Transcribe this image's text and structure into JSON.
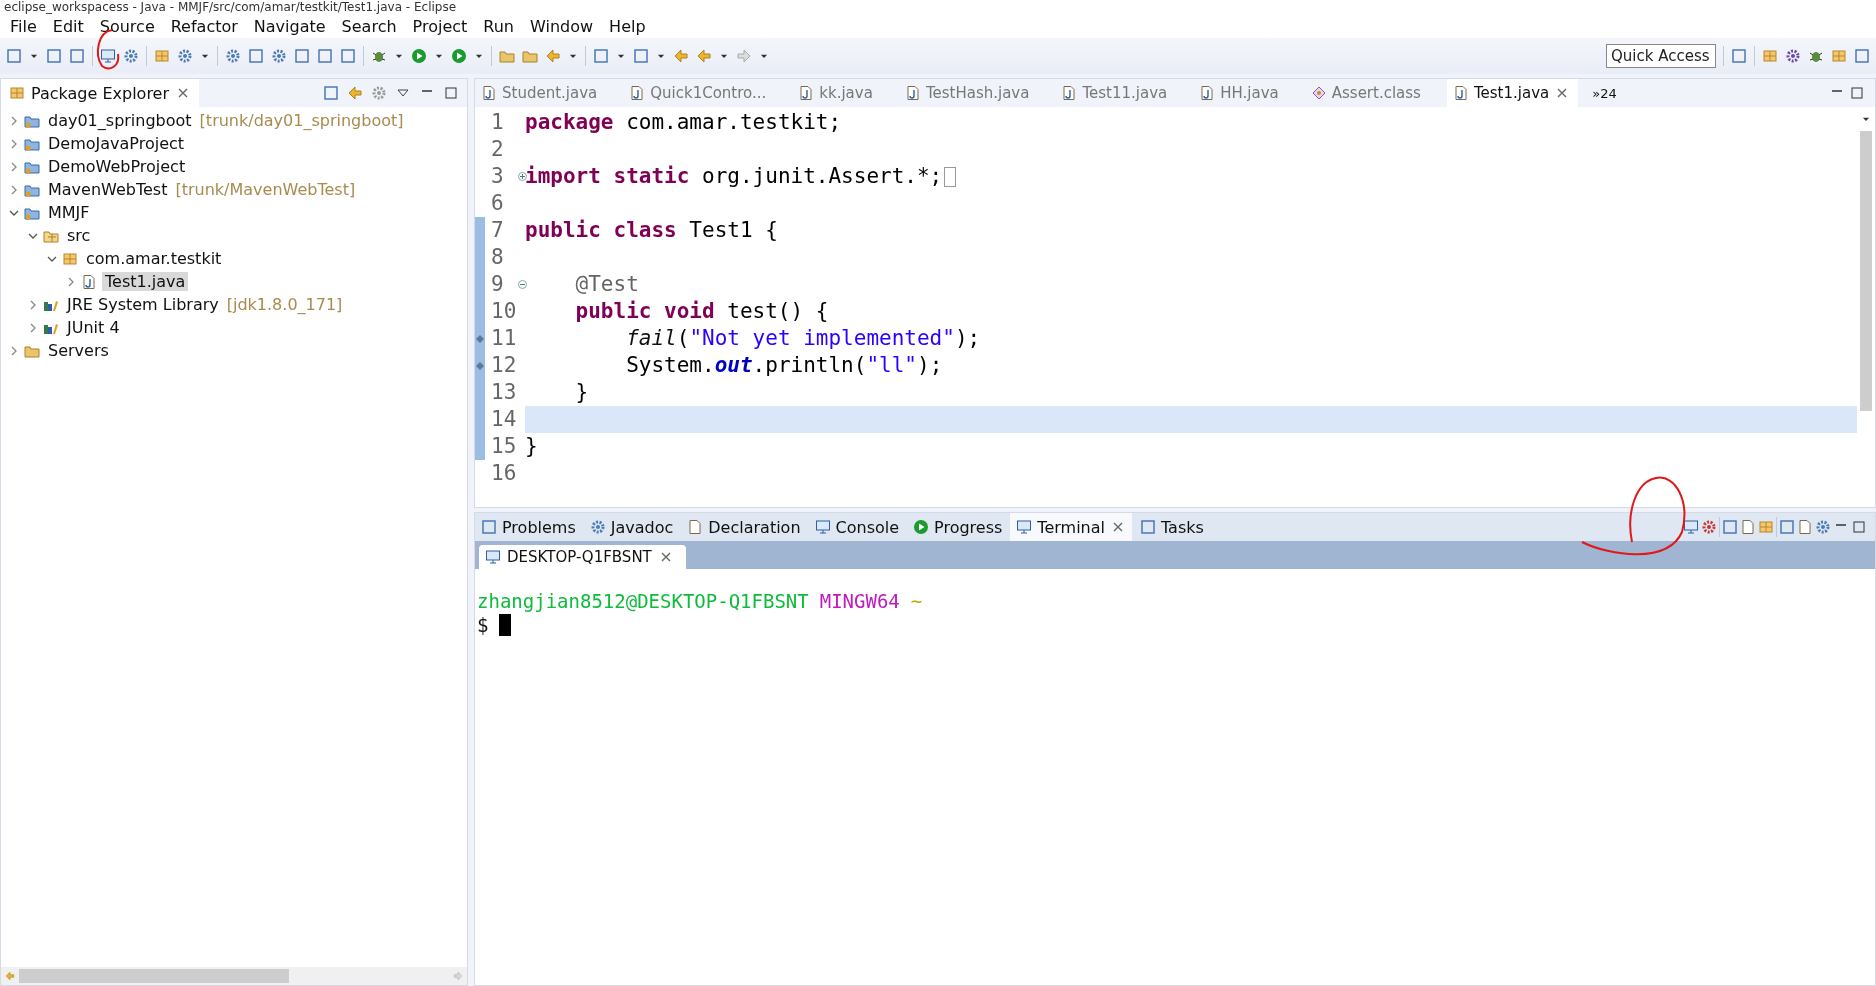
{
  "window": {
    "title": "eclipse_workspacess - Java - MMJF/src/com/amar/testkit/Test1.java - Eclipse"
  },
  "menu": [
    "File",
    "Edit",
    "Source",
    "Refactor",
    "Navigate",
    "Search",
    "Project",
    "Run",
    "Window",
    "Help"
  ],
  "quick_access": {
    "placeholder": "Quick Access"
  },
  "package_explorer": {
    "title": "Package Explorer",
    "items": [
      {
        "label": "day01_springboot",
        "decoration": "[trunk/day01_springboot]",
        "kind": "project",
        "expanded": false,
        "selected": false
      },
      {
        "label": "DemoJavaProject",
        "kind": "project",
        "expanded": false,
        "selected": false
      },
      {
        "label": "DemoWebProject",
        "kind": "project",
        "expanded": false,
        "selected": false
      },
      {
        "label": "MavenWebTest",
        "decoration": "[trunk/MavenWebTest]",
        "kind": "project",
        "expanded": false,
        "selected": false
      },
      {
        "label": "MMJF",
        "kind": "project",
        "expanded": true,
        "selected": false,
        "children": [
          {
            "label": "src",
            "kind": "source",
            "expanded": true,
            "selected": false,
            "children": [
              {
                "label": "com.amar.testkit",
                "kind": "package",
                "expanded": true,
                "selected": false,
                "children": [
                  {
                    "label": "Test1.java",
                    "kind": "java",
                    "expanded": false,
                    "selected": true
                  }
                ]
              }
            ]
          },
          {
            "label": "JRE System Library",
            "decoration": "[jdk1.8.0_171]",
            "kind": "library",
            "expanded": false,
            "selected": false
          },
          {
            "label": "JUnit 4",
            "kind": "library",
            "expanded": false,
            "selected": false
          }
        ]
      },
      {
        "label": "Servers",
        "kind": "folder",
        "expanded": false,
        "selected": false
      }
    ]
  },
  "editor_tabs": [
    {
      "label": "Student.java",
      "kind": "java",
      "selected": false
    },
    {
      "label": "Quick1Contro...",
      "kind": "java",
      "selected": false
    },
    {
      "label": "kk.java",
      "kind": "java",
      "selected": false
    },
    {
      "label": "TestHash.java",
      "kind": "java",
      "selected": false
    },
    {
      "label": "Test11.java",
      "kind": "java",
      "selected": false
    },
    {
      "label": "HH.java",
      "kind": "java",
      "selected": false
    },
    {
      "label": "Assert.class",
      "kind": "class",
      "selected": false
    },
    {
      "label": "Test1.java",
      "kind": "java",
      "selected": true
    }
  ],
  "tab_overflow": "»24",
  "code": [
    {
      "number": "1",
      "kind": "top",
      "changed": false,
      "current": false,
      "tokens": [
        {
          "kind": "keyword",
          "text": "package"
        },
        {
          "kind": "plain",
          "text": " com.amar.testkit;"
        }
      ]
    },
    {
      "number": "2",
      "changed": false,
      "current": false
    },
    {
      "number": "3",
      "kind": "top",
      "changed": false,
      "current": false,
      "fold": {
        "collapsed": true
      },
      "tokens": [
        {
          "kind": "keyword",
          "text": "import static"
        },
        {
          "kind": "plain",
          "text": " org.junit.Assert.*;"
        }
      ]
    },
    {
      "number": "6",
      "changed": false,
      "current": false
    },
    {
      "number": "7",
      "kind": "top",
      "changed": true,
      "current": false,
      "tokens": [
        {
          "kind": "keyword",
          "text": "public class"
        },
        {
          "kind": "plain",
          "text": " Test1 {"
        }
      ]
    },
    {
      "number": "8",
      "changed": true,
      "current": false
    },
    {
      "number": "9",
      "kind": "member",
      "changed": true,
      "current": false,
      "fold": {
        "collapsed": false
      },
      "tokens": [
        {
          "kind": "annotation",
          "text": "@Test"
        }
      ]
    },
    {
      "number": "10",
      "kind": "member",
      "changed": true,
      "current": false,
      "tokens": [
        {
          "kind": "keyword",
          "text": "public void"
        },
        {
          "kind": "plain",
          "text": " test() {"
        }
      ]
    },
    {
      "number": "11",
      "kind": "statement",
      "changed": true,
      "current": false,
      "marker": true,
      "tokens": [
        {
          "kind": "method",
          "text": "fail"
        },
        {
          "kind": "plain",
          "text": "("
        },
        {
          "kind": "string",
          "text": "\"Not yet implemented\""
        },
        {
          "kind": "plain",
          "text": ");"
        }
      ]
    },
    {
      "number": "12",
      "kind": "statement",
      "changed": true,
      "current": false,
      "marker": true,
      "tokens": [
        {
          "kind": "plain",
          "text": "System."
        },
        {
          "kind": "field",
          "text": "out"
        },
        {
          "kind": "plain",
          "text": ".println("
        },
        {
          "kind": "string",
          "text": "\"ll\""
        },
        {
          "kind": "plain",
          "text": ");"
        }
      ]
    },
    {
      "number": "13",
      "kind": "member",
      "changed": true,
      "current": false,
      "tokens": [
        {
          "kind": "plain",
          "text": "}"
        }
      ]
    },
    {
      "number": "14",
      "changed": true,
      "current": true
    },
    {
      "number": "15",
      "kind": "top",
      "changed": true,
      "current": false,
      "tokens": [
        {
          "kind": "plain",
          "text": "}"
        }
      ]
    },
    {
      "number": "16",
      "changed": false,
      "current": false
    }
  ],
  "bottom_tabs": [
    {
      "label": "Problems",
      "selected": false
    },
    {
      "label": "Javadoc",
      "selected": false
    },
    {
      "label": "Declaration",
      "selected": false
    },
    {
      "label": "Console",
      "selected": false
    },
    {
      "label": "Progress",
      "selected": false
    },
    {
      "label": "Terminal",
      "selected": true
    },
    {
      "label": "Tasks",
      "selected": false
    }
  ],
  "terminal": {
    "tab": "DESKTOP-Q1FBSNT",
    "prompt": [
      {
        "kind": "user",
        "text": "zhangjian8512@DESKTOP-Q1FBSNT"
      },
      {
        "kind": "system",
        "text": "MINGW64"
      },
      {
        "kind": "path",
        "text": "~"
      }
    ],
    "input": "$"
  }
}
